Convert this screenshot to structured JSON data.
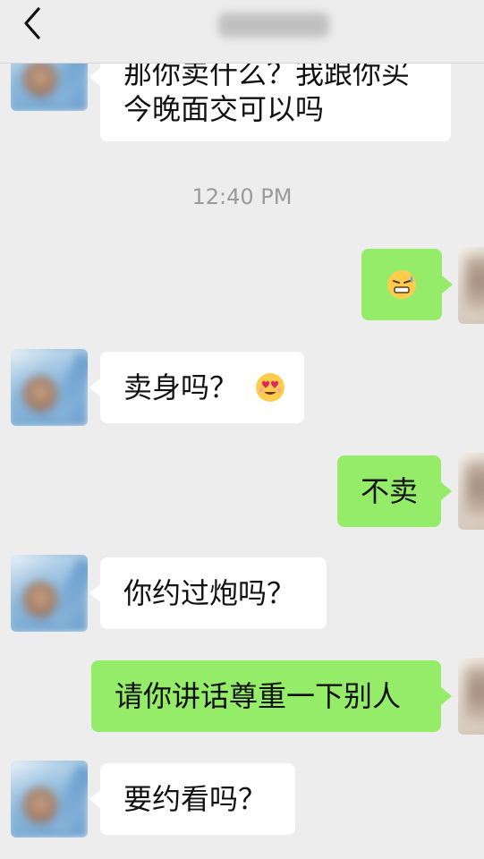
{
  "header": {
    "back_icon": "chevron-left-icon",
    "title_blurred": true
  },
  "timestamp": "12:40 PM",
  "messages": [
    {
      "side": "left",
      "lines": [
        "那你卖什么？我跟你买",
        "今晚面交可以吗"
      ]
    },
    {
      "side": "right",
      "emoji": "grimace-sweat-emoji"
    },
    {
      "side": "left",
      "text": "卖身吗？",
      "emoji": "heart-eyes-emoji"
    },
    {
      "side": "right",
      "text": "不卖"
    },
    {
      "side": "left",
      "text": "你约过炮吗？"
    },
    {
      "side": "right",
      "text": "请你讲话尊重一下别人"
    },
    {
      "side": "left",
      "text": "要约看吗？"
    }
  ],
  "colors": {
    "background": "#ededed",
    "bubble_left": "#ffffff",
    "bubble_right": "#95ec69",
    "timestamp_text": "#9a9a9a"
  }
}
